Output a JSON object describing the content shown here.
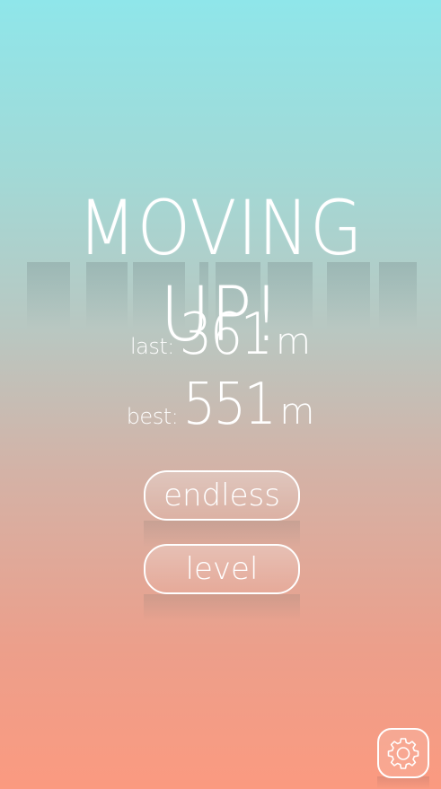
{
  "game": {
    "title": "MOVING UP!"
  },
  "stats": {
    "last": {
      "label": "last:",
      "value": "361",
      "unit": "m"
    },
    "best": {
      "label": "best:",
      "value": "551",
      "unit": "m"
    }
  },
  "buttons": {
    "endless_label": "endless",
    "level_label": "level"
  },
  "icons": {
    "settings": "gear-icon"
  },
  "colors": {
    "gradient_top": "#8fe6ea",
    "gradient_bottom": "#fb9a80",
    "text": "#ffffff"
  }
}
